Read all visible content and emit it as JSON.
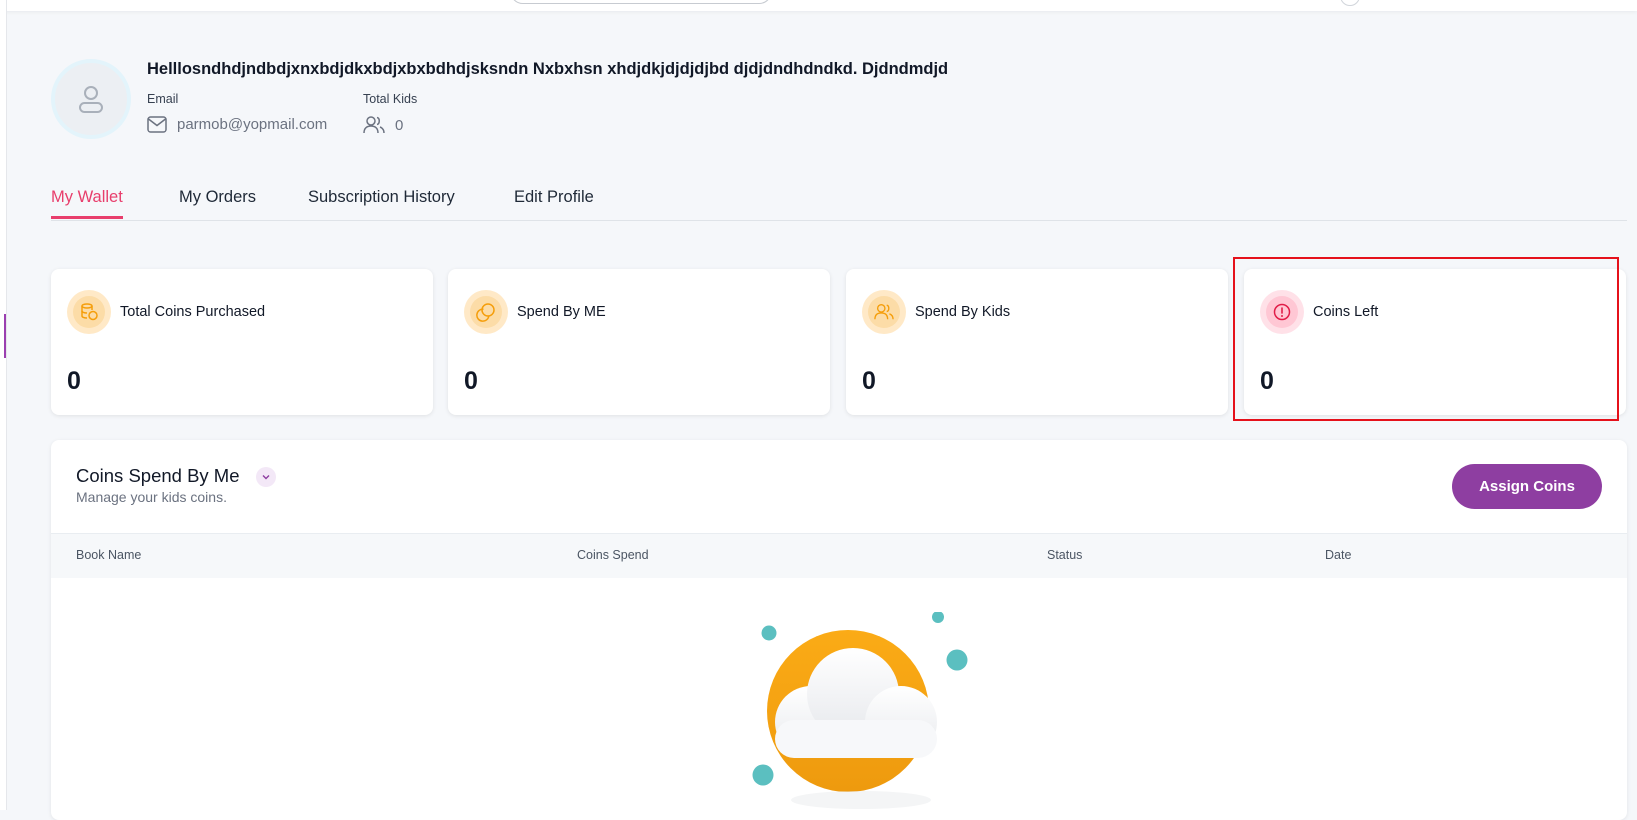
{
  "profile": {
    "name": "Helllosndhdjndbdjxnxbdjdkxbdjxbxbdhdjsksndn Nxbxhsn xhdjdkjdjdjdjbd djdjdndhdndkd. Djdndmdjd",
    "email_label": "Email",
    "email": "parmob@yopmail.com",
    "kids_label": "Total Kids",
    "kids_count": "0"
  },
  "tabs": [
    {
      "label": "My Wallet",
      "active": true
    },
    {
      "label": "My Orders",
      "active": false
    },
    {
      "label": "Subscription History",
      "active": false
    },
    {
      "label": "Edit Profile",
      "active": false
    }
  ],
  "stats": [
    {
      "title": "Total Coins Purchased",
      "value": "0",
      "icon": "coins-stack-icon"
    },
    {
      "title": "Spend By ME",
      "value": "0",
      "icon": "coins-icon"
    },
    {
      "title": "Spend By Kids",
      "value": "0",
      "icon": "users-icon"
    },
    {
      "title": "Coins Left",
      "value": "0",
      "icon": "alert-circle-icon"
    }
  ],
  "panel": {
    "title": "Coins Spend By Me",
    "subtitle": "Manage your kids coins.",
    "assign_button": "Assign Coins",
    "columns": [
      "Book Name",
      "Coins Spend",
      "Status",
      "Date"
    ]
  },
  "colors": {
    "accent": "#e83e6c",
    "primary_button": "#8e3ea1",
    "highlight": "#e5111b",
    "orange": "#f7a21b",
    "teal": "#5bbfc0"
  }
}
